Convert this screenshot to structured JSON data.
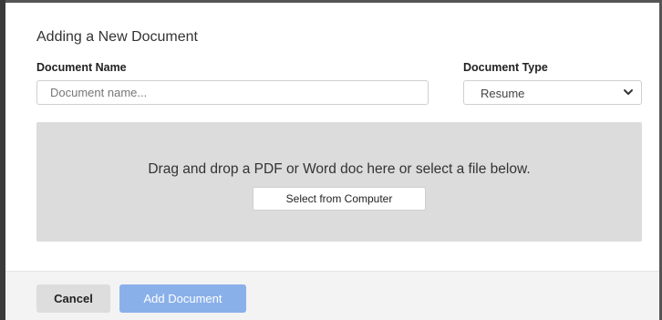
{
  "dialog": {
    "title": "Adding a New Document"
  },
  "form": {
    "document_name_label": "Document Name",
    "document_name_placeholder": "Document name...",
    "document_name_value": "",
    "document_type_label": "Document Type",
    "document_type_selected": "Resume",
    "document_type_icon": "chevron-down-icon"
  },
  "dropzone": {
    "message": "Drag and drop a PDF or Word doc here or select a file below.",
    "select_button_label": "Select from Computer"
  },
  "footer": {
    "cancel_label": "Cancel",
    "add_label": "Add Document"
  },
  "colors": {
    "primary_button_disabled": "#8ab0ea",
    "dropzone_bg": "#dcdcdc",
    "footer_bg": "#f3f3f3"
  }
}
